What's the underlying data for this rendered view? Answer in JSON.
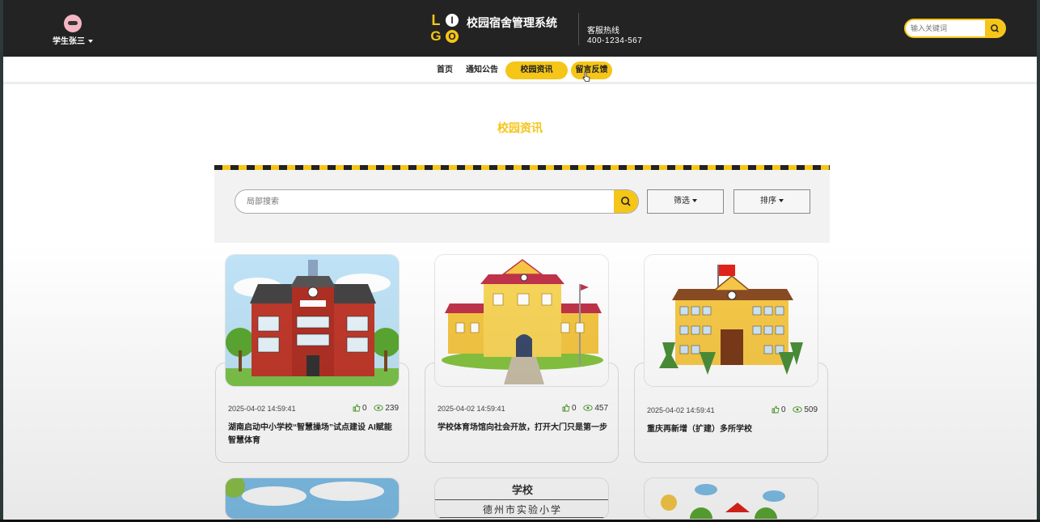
{
  "header": {
    "user_name": "学生张三",
    "site_title": "校园宿舍管理系统",
    "hotline_label": "客服热线",
    "hotline_number": "400-1234-567",
    "search_placeholder": "输入关键词",
    "logo": [
      "L",
      "I",
      "G",
      "O"
    ]
  },
  "nav": {
    "items": [
      "首页",
      "通知公告",
      "校园资讯",
      "留言反馈"
    ],
    "active": "校园资讯"
  },
  "page": {
    "section_title": "校园资讯",
    "local_search_placeholder": "局部搜索",
    "filter_label": "筛选",
    "sort_label": "排序"
  },
  "cards": [
    {
      "date": "2025-04-02 14:59:41",
      "likes": "0",
      "views": "239",
      "title": "湖南启动中小学校“智慧操场”试点建设 AI赋能智慧体育"
    },
    {
      "date": "2025-04-02 14:59:41",
      "likes": "0",
      "views": "457",
      "title": "学校体育场馆向社会开放，打开大门只是第一步"
    },
    {
      "date": "2025-04-02 14:59:41",
      "likes": "0",
      "views": "509",
      "title": "重庆再新增（扩建）多所学校"
    }
  ],
  "second_row": {
    "card2_sign_top": "学校",
    "card2_sign_bottom": "德州市实验小学"
  },
  "colors": {
    "accent": "#f5c518",
    "header_bg": "#232323"
  }
}
